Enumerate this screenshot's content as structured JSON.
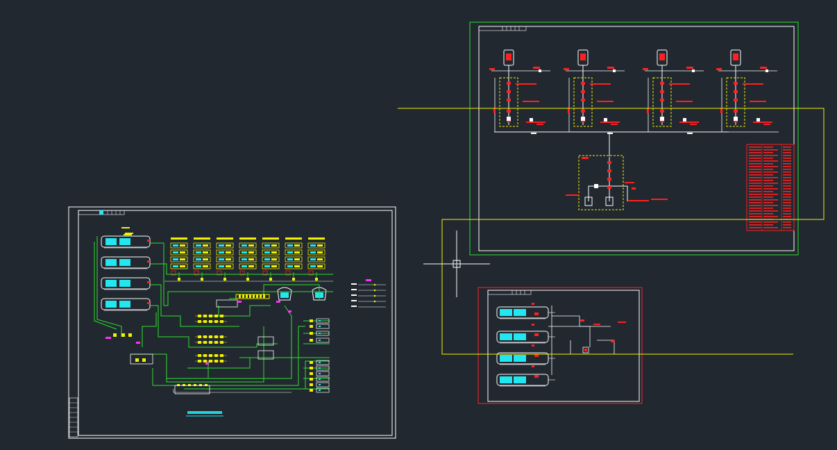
{
  "colors": {
    "background": "#212830",
    "frame": "#ffffff",
    "pipe_green": "#2ee02e",
    "equipment_cyan": "#22e6f0",
    "label_yellow": "#f2f200",
    "valve_red": "#ff2020",
    "accent_magenta": "#ff30ff",
    "crosshair": "#ffffff"
  },
  "icons": {
    "cursor": "crosshair-icon",
    "chiller": "chiller-icon",
    "cooling_tower": "cooling-tower-icon",
    "pump": "pump-icon",
    "valve": "valve-icon",
    "water_heater": "water-heater-icon"
  },
  "sheet_left": {
    "title": "",
    "legend_title": ""
  },
  "sheet_top_right": {
    "title": ""
  },
  "sheet_bottom_right": {
    "title": ""
  }
}
